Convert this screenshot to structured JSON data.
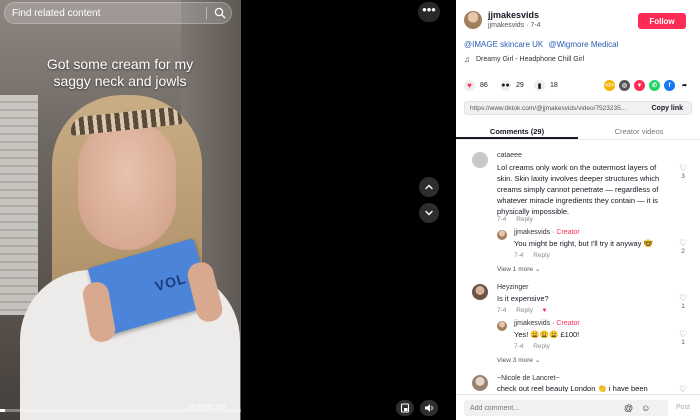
{
  "search": {
    "placeholder": "Find related content"
  },
  "video": {
    "caption_line1": "Got some cream for my",
    "caption_line2": "saggy neck and jowls",
    "product_text": "VOL",
    "time": "00:00/01:03",
    "progress_fraction": 0.02
  },
  "author": {
    "name": "jjmakesvids",
    "meta": "jjmakesvids · 7-4",
    "follow_label": "Follow"
  },
  "description": {
    "mentions": [
      "@IMAGE skincare UK",
      "@Wigmore Medical"
    ],
    "music": "Dreamy Girl - Headphone Chill Girl"
  },
  "stats": {
    "likes": "86",
    "comments": "29",
    "saves": "18"
  },
  "share_icons": [
    {
      "name": "embed-icon",
      "color": "#f5b301",
      "glyph": "</>"
    },
    {
      "name": "friends-share-icon",
      "color": "#555555",
      "glyph": "◎"
    },
    {
      "name": "repost-icon",
      "color": "#fe2c55",
      "glyph": "▼"
    },
    {
      "name": "whatsapp-icon",
      "color": "#25d366",
      "glyph": "✆"
    },
    {
      "name": "facebook-icon",
      "color": "#1877f2",
      "glyph": "f"
    },
    {
      "name": "share-arrow-icon",
      "color": "#ffffff",
      "glyph": "➦"
    }
  ],
  "link": {
    "url": "https://www.tiktok.com/@jjmakesvids/video/7523235...",
    "copy_label": "Copy link"
  },
  "tabs": {
    "comments": "Comments (29)",
    "creator_videos": "Creator videos"
  },
  "comments": [
    {
      "user": "cataeee",
      "text": "Lol creams only work on the outermost layers of skin. Skin laxity involves deeper structures which creams simply cannot penetrate — regardless of whatever miracle ingredients they contain — it is physically impossible.",
      "date": "7-4",
      "reply_label": "Reply",
      "likes": "3",
      "reply": {
        "user": "jjmakesvids",
        "badge": "Creator",
        "text": "You might be right, but I'll try it anyway 🤓",
        "date": "7-4",
        "reply_label": "Reply",
        "likes": "2"
      },
      "view_more": "View 1 more"
    },
    {
      "user": "Heyzinger",
      "text": "Is it expensive?",
      "date": "7-4",
      "reply_label": "Reply",
      "likes": "1",
      "reply": {
        "user": "jjmakesvids",
        "badge": "Creator",
        "text": "Yes! 😩😩😩 £100!",
        "date": "7-4",
        "reply_label": "Reply",
        "likes": "1"
      },
      "view_more": "View 3 more"
    },
    {
      "user": "~Nicole de Lancret~",
      "text": "check out reel beauty London 👏 i have been",
      "likes": "1"
    }
  ],
  "compose": {
    "placeholder": "Add comment...",
    "post_label": "Post"
  }
}
